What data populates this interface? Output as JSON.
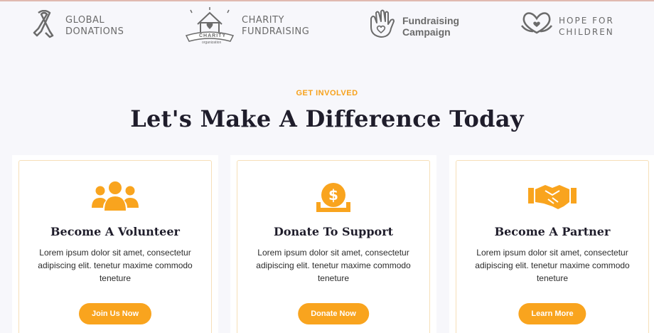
{
  "partners": [
    {
      "text": "GLOBAL\nDONATIONS",
      "icon": "ribbon-icon"
    },
    {
      "text": "CHARITY\nFUNDRAISING",
      "badge": "CHARITY",
      "sub": "organization",
      "icon": "house-heart-icon"
    },
    {
      "text": "Fundraising\nCampaign",
      "icon": "hand-heart-icon"
    },
    {
      "text": "HOPE FOR\nCHILDREN",
      "icon": "hands-heart-icon"
    }
  ],
  "section": {
    "eyebrow": "GET INVOLVED",
    "heading": "Let's Make A Difference Today"
  },
  "cards": [
    {
      "icon": "group-icon",
      "title": "Become A Volunteer",
      "text": "Lorem ipsum dolor sit amet, consectetur adipiscing elit. tenetur maxime  commodo teneture",
      "button": "Join Us Now"
    },
    {
      "icon": "coin-dollar-icon",
      "title": "Donate To Support",
      "text": "Lorem ipsum dolor sit amet, consectetur adipiscing elit. tenetur maxime  commodo teneture",
      "button": "Donate Now"
    },
    {
      "icon": "handshake-icon",
      "title": "Become A Partner",
      "text": "Lorem ipsum dolor sit amet, consectetur adipiscing elit. tenetur maxime  commodo teneture",
      "button": "Learn More"
    }
  ],
  "colors": {
    "accent": "#f9a41e",
    "heading": "#1f1d2b",
    "background": "#f7f7fb",
    "card_border": "#f6dfb8"
  }
}
